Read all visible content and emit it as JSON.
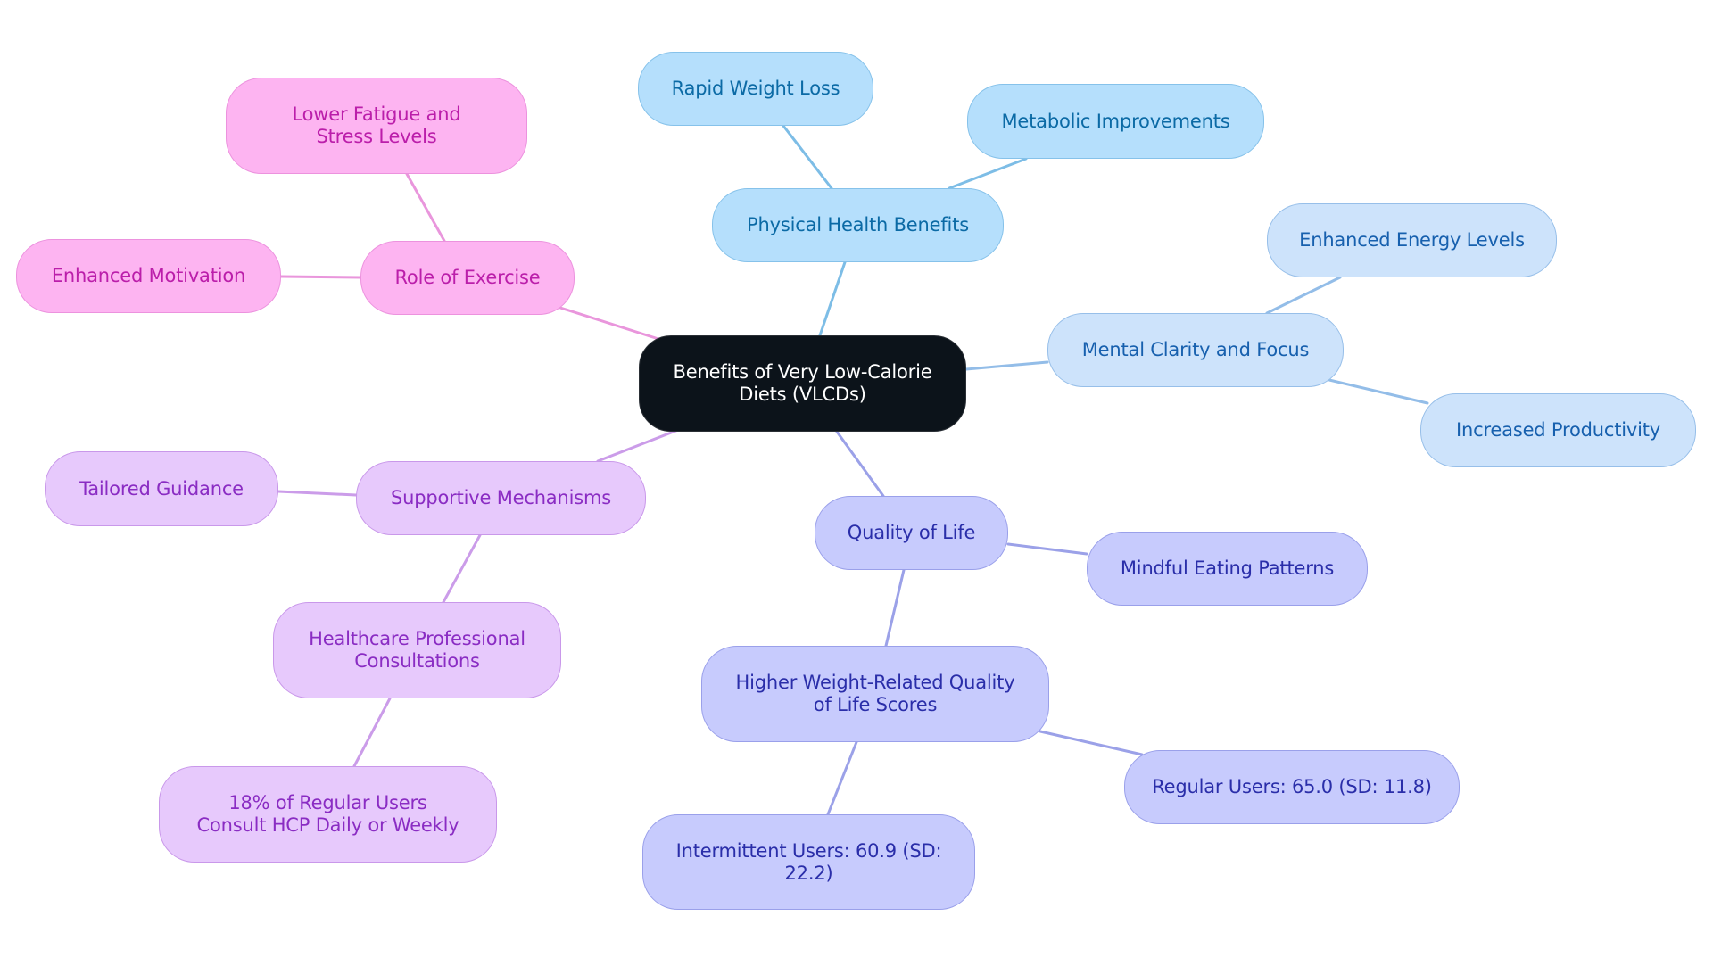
{
  "diagram": {
    "type": "mind-map",
    "root": {
      "id": "root",
      "label": "Benefits of Very Low-Calorie Diets (VLCDs)"
    },
    "nodes": [
      {
        "id": "physical",
        "parent": "root",
        "label": "Physical Health Benefits",
        "color_group": "blue1"
      },
      {
        "id": "rapid",
        "parent": "physical",
        "label": "Rapid Weight Loss",
        "color_group": "blue1"
      },
      {
        "id": "metabolic",
        "parent": "physical",
        "label": "Metabolic Improvements",
        "color_group": "blue1"
      },
      {
        "id": "mental",
        "parent": "root",
        "label": "Mental Clarity and Focus",
        "color_group": "blue2"
      },
      {
        "id": "energy",
        "parent": "mental",
        "label": "Enhanced Energy Levels",
        "color_group": "blue2"
      },
      {
        "id": "productivity",
        "parent": "mental",
        "label": "Increased Productivity",
        "color_group": "blue2"
      },
      {
        "id": "exercise",
        "parent": "root",
        "label": "Role of Exercise",
        "color_group": "pink"
      },
      {
        "id": "fatigue",
        "parent": "exercise",
        "label": "Lower Fatigue and Stress Levels",
        "color_group": "pink"
      },
      {
        "id": "motivation",
        "parent": "exercise",
        "label": "Enhanced Motivation",
        "color_group": "pink"
      },
      {
        "id": "supportive",
        "parent": "root",
        "label": "Supportive Mechanisms",
        "color_group": "lilac"
      },
      {
        "id": "tailored",
        "parent": "supportive",
        "label": "Tailored Guidance",
        "color_group": "lilac"
      },
      {
        "id": "hcp",
        "parent": "supportive",
        "label": "Healthcare Professional Consultations",
        "color_group": "lilac"
      },
      {
        "id": "hcp18",
        "parent": "hcp",
        "label": "18% of Regular Users Consult HCP Daily or Weekly",
        "color_group": "lilac"
      },
      {
        "id": "qol",
        "parent": "root",
        "label": "Quality of Life",
        "color_group": "indigo"
      },
      {
        "id": "mindful",
        "parent": "qol",
        "label": "Mindful Eating Patterns",
        "color_group": "indigo"
      },
      {
        "id": "wrqol",
        "parent": "qol",
        "label": "Higher Weight-Related Quality of Life Scores",
        "color_group": "indigo"
      },
      {
        "id": "regular",
        "parent": "wrqol",
        "label": "Regular Users: 65.0 (SD: 11.8)",
        "color_group": "indigo"
      },
      {
        "id": "intermittent",
        "parent": "wrqol",
        "label": "Intermittent Users: 60.9 (SD: 22.2)",
        "color_group": "indigo"
      }
    ],
    "colors": {
      "root_fill": "#0c131a",
      "blue1_fill": "#b5dffc",
      "blue1_edge": "#7dbde6",
      "blue2_fill": "#cde3fb",
      "blue2_edge": "#93bde8",
      "pink_fill": "#fdb4f1",
      "pink_edge": "#e996dc",
      "lilac_fill": "#e7c9fc",
      "lilac_edge": "#cb9ce9",
      "indigo_fill": "#c7cbfd",
      "indigo_edge": "#9ba1e8"
    }
  }
}
